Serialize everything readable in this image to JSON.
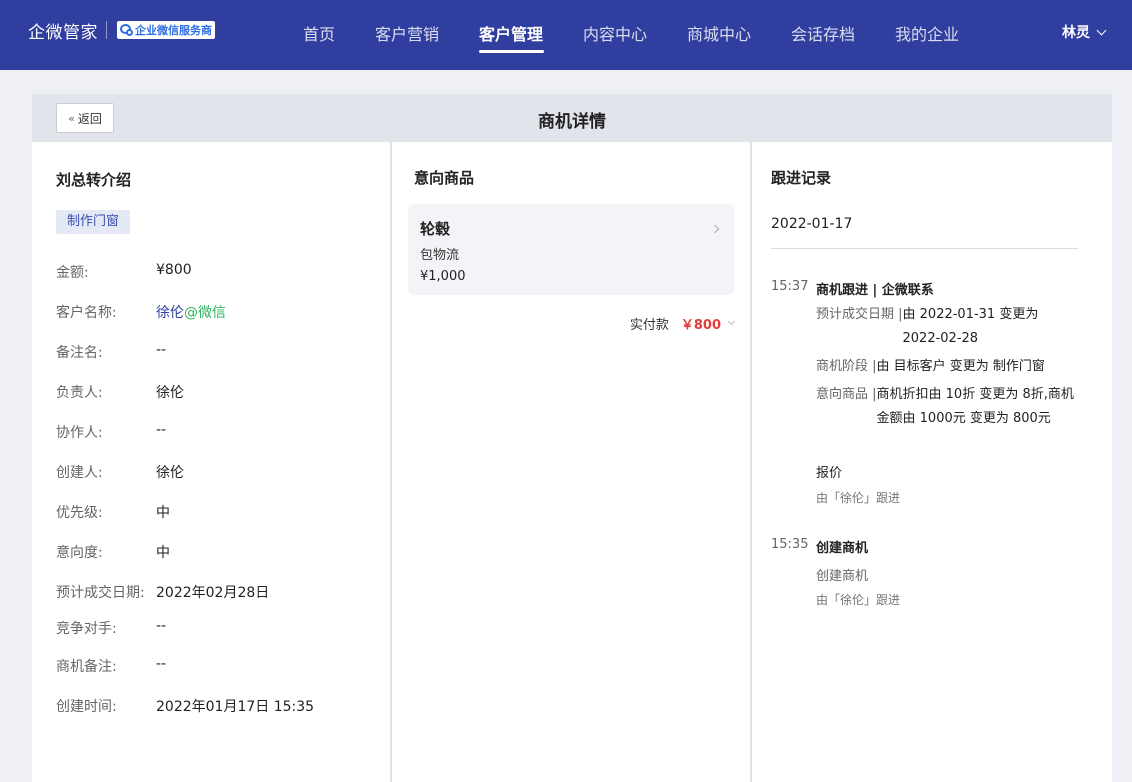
{
  "header": {
    "brand": "企微管家",
    "badge": "企业微信服务商",
    "nav": [
      "首页",
      "客户营销",
      "客户管理",
      "内容中心",
      "商城中心",
      "会话存档",
      "我的企业"
    ],
    "active_nav_index": 2,
    "user": "林灵"
  },
  "page": {
    "back_label": "返回",
    "title": "商机详情"
  },
  "opportunity": {
    "name": "刘总转介绍",
    "stage_tag": "制作门窗",
    "fields": [
      {
        "label": "金额:",
        "value": "¥800"
      },
      {
        "label": "客户名称:",
        "value": "徐伦",
        "suffix": "@微信"
      },
      {
        "label": "备注名:",
        "value": "--"
      },
      {
        "label": "负责人:",
        "value": "徐伦"
      },
      {
        "label": "协作人:",
        "value": "--"
      },
      {
        "label": "创建人:",
        "value": "徐伦"
      },
      {
        "label": "优先级:",
        "value": "中"
      },
      {
        "label": "意向度:",
        "value": "中"
      },
      {
        "label": "预计成交日期:",
        "value": "2022年02月28日"
      },
      {
        "label": "竞争对手:",
        "value": "--"
      },
      {
        "label": "商机备注:",
        "value": "--"
      },
      {
        "label": "创建时间:",
        "value": "2022年01月17日 15:35"
      }
    ]
  },
  "products": {
    "title": "意向商品",
    "items": [
      {
        "name": "轮毂",
        "note": "包物流",
        "price": "¥1,000"
      }
    ],
    "paid_label": "实付款",
    "paid_value": "￥800"
  },
  "records": {
    "title": "跟进记录",
    "date": "2022-01-17",
    "entries": [
      {
        "time": "15:37",
        "head": "商机跟进 | 企微联系",
        "changes": [
          {
            "label": "预计成交日期 | ",
            "value": "由 2022-01-31 变更为 2022-02-28"
          },
          {
            "label": "商机阶段 | ",
            "value": "由 目标客户 变更为 制作门窗"
          },
          {
            "label": "意向商品 | ",
            "value": "商机折扣由 10折 变更为 8折,商机金额由 1000元 变更为 800元"
          }
        ],
        "note": "报价",
        "by": "由「徐伦」跟进"
      },
      {
        "time": "15:35",
        "head": "创建商机",
        "note": "创建商机",
        "by": "由「徐伦」跟进"
      }
    ]
  }
}
